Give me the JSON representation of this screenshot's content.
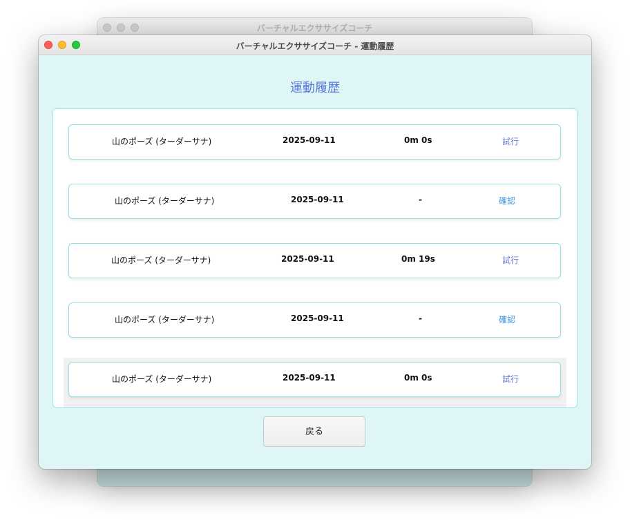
{
  "background_window": {
    "title": "バーチャルエクササイズコーチ"
  },
  "window": {
    "title": "バーチャルエクササイズコーチ - 運動履歴"
  },
  "page": {
    "title": "運動履歴"
  },
  "history": [
    {
      "exercise": "山のポーズ (ターダーサナ)",
      "date": "2025-09-11",
      "duration": "0m 0s",
      "action": "試行"
    },
    {
      "exercise": "山のポーズ (ターダーサナ)",
      "date": "2025-09-11",
      "duration": "-",
      "action": "確認"
    },
    {
      "exercise": "山のポーズ (ターダーサナ)",
      "date": "2025-09-11",
      "duration": "0m 19s",
      "action": "試行"
    },
    {
      "exercise": "山のポーズ (ターダーサナ)",
      "date": "2025-09-11",
      "duration": "-",
      "action": "確認"
    },
    {
      "exercise": "山のポーズ (ターダーサナ)",
      "date": "2025-09-11",
      "duration": "0m 0s",
      "action": "試行"
    }
  ],
  "footer": {
    "back_label": "戻る"
  },
  "colors": {
    "accent": "#5b76d6",
    "link_try": "#6a7ad6",
    "link_confirm": "#3e94dc",
    "window_bg": "#dff6f7",
    "border": "#93e1e4"
  }
}
